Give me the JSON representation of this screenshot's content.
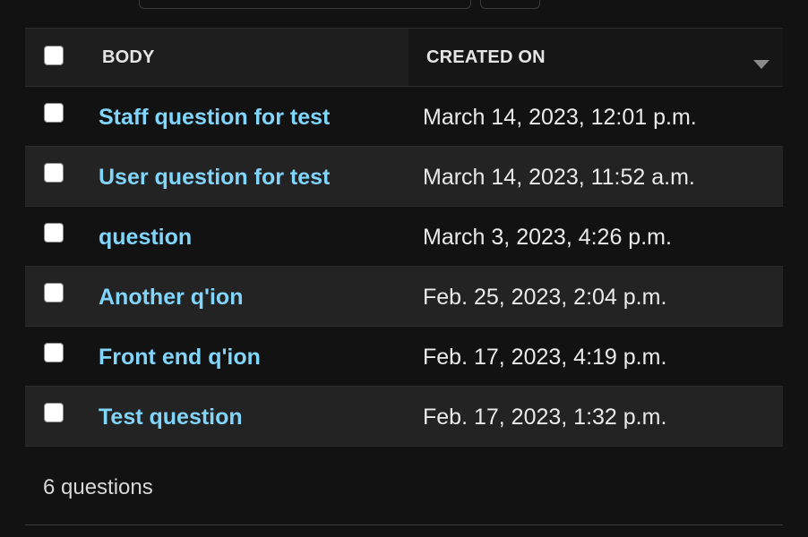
{
  "table": {
    "columns": {
      "body": "BODY",
      "created_on": "CREATED ON"
    },
    "sort_icon": "caret-down-icon",
    "rows": [
      {
        "body": "Staff question for test",
        "created_on": "March 14, 2023, 12:01 p.m."
      },
      {
        "body": "User question for test",
        "created_on": "March 14, 2023, 11:52 a.m."
      },
      {
        "body": "question",
        "created_on": "March 3, 2023, 4:26 p.m."
      },
      {
        "body": "Another q'ion",
        "created_on": "Feb. 25, 2023, 2:04 p.m."
      },
      {
        "body": "Front end q'ion",
        "created_on": "Feb. 17, 2023, 4:19 p.m."
      },
      {
        "body": "Test question",
        "created_on": "Feb. 17, 2023, 1:32 p.m."
      }
    ]
  },
  "footer": {
    "count_text": "6 questions"
  },
  "colors": {
    "background": "#121212",
    "link": "#81d4fa",
    "row_alt": "#232323",
    "header": "#1e1e1e"
  }
}
